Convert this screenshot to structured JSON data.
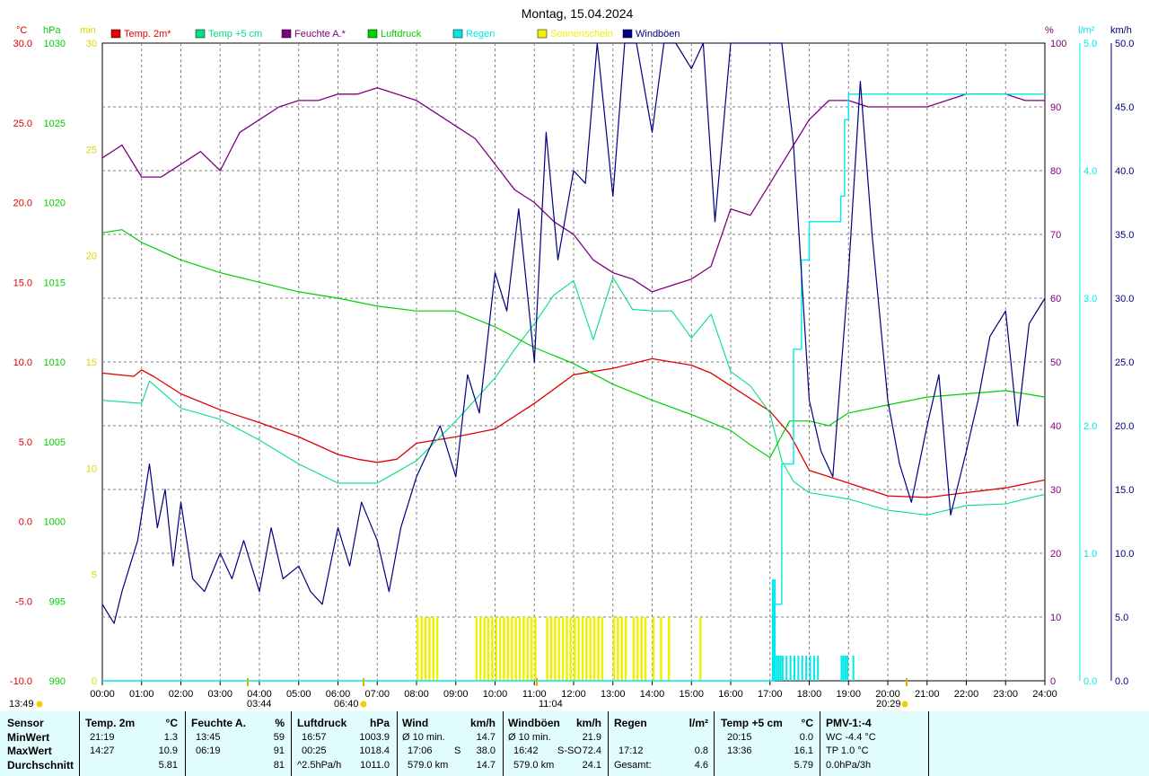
{
  "title": "Montag, 15.04.2024",
  "colors": {
    "temp2m": "#e00000",
    "temp5cm": "#00e080",
    "feuchte": "#800080",
    "luftdruck": "#00d000",
    "regen": "#00e8e8",
    "sonne": "#f0f000",
    "wind": "#000080",
    "grid": "#808080",
    "panel": "#e1fcfc"
  },
  "legend": [
    {
      "key": "temp2m",
      "label": "Temp. 2m*",
      "color": "#e00000"
    },
    {
      "key": "temp5cm",
      "label": "Temp +5 cm",
      "color": "#00e080"
    },
    {
      "key": "feuchte",
      "label": "Feuchte A.*",
      "color": "#800080"
    },
    {
      "key": "luftdruck",
      "label": "Luftdruck",
      "color": "#00d000"
    },
    {
      "key": "regen",
      "label": "Regen",
      "color": "#00e8e8"
    },
    {
      "key": "sonne",
      "label": "Sonnenschein",
      "color": "#f0f000"
    },
    {
      "key": "wind",
      "label": "Windböen",
      "color": "#000080"
    }
  ],
  "chart_data": {
    "type": "line",
    "title": "Montag, 15.04.2024",
    "x_ticks": [
      "00:00",
      "01:00",
      "02:00",
      "03:00",
      "04:00",
      "05:00",
      "06:00",
      "07:00",
      "08:00",
      "09:00",
      "10:00",
      "11:00",
      "12:00",
      "13:00",
      "14:00",
      "15:00",
      "16:00",
      "17:00",
      "18:00",
      "19:00",
      "20:00",
      "21:00",
      "22:00",
      "23:00",
      "24:00"
    ],
    "axes": {
      "temp_c": {
        "unit": "°C",
        "range": [
          -10,
          30
        ],
        "ticks": [
          "30.0",
          "25.0",
          "20.0",
          "15.0",
          "10.0",
          "5.0",
          "0.0",
          "-5.0",
          "-10.0"
        ]
      },
      "pressure_hpa": {
        "unit": "hPa",
        "range": [
          990,
          1030
        ],
        "ticks": [
          "1030",
          "1025",
          "1020",
          "1015",
          "1010",
          "1005",
          "1000",
          "995",
          "990"
        ]
      },
      "sun_min": {
        "unit": "min",
        "range": [
          0,
          30
        ],
        "ticks": [
          "30",
          "25",
          "20",
          "15",
          "10",
          "5",
          "0"
        ]
      },
      "humidity_pct": {
        "unit": "%",
        "range": [
          0,
          100
        ],
        "ticks": [
          "100",
          "90",
          "80",
          "70",
          "60",
          "50",
          "40",
          "30",
          "20",
          "10",
          "0"
        ]
      },
      "rain_l": {
        "unit": "l/m²",
        "range": [
          0,
          5
        ],
        "ticks": [
          "5.0",
          "4.0",
          "3.0",
          "2.0",
          "1.0",
          "0.0"
        ]
      },
      "wind_kmh": {
        "unit": "km/h",
        "range": [
          0,
          50
        ],
        "ticks": [
          "50.0",
          "45.0",
          "40.0",
          "35.0",
          "30.0",
          "25.0",
          "20.0",
          "15.0",
          "10.0",
          "5.0",
          "0.0"
        ]
      }
    },
    "series": [
      {
        "name": "Temp. 2m*",
        "axis": "temp_c",
        "x": [
          0,
          0.8,
          1,
          1.3,
          2,
          3,
          4,
          5,
          6,
          6.5,
          7,
          7.5,
          8,
          9,
          10,
          11,
          12,
          13,
          14,
          14.5,
          15,
          15.5,
          16,
          17,
          17.5,
          18,
          18.5,
          19,
          20,
          21,
          22,
          23,
          24
        ],
        "y": [
          9.3,
          9.1,
          9.5,
          9.1,
          8.0,
          7.0,
          6.2,
          5.3,
          4.2,
          3.9,
          3.7,
          3.9,
          4.9,
          5.3,
          5.8,
          7.4,
          9.2,
          9.6,
          10.2,
          10.0,
          9.8,
          9.3,
          8.5,
          6.9,
          5.5,
          3.2,
          2.8,
          2.4,
          1.6,
          1.5,
          1.8,
          2.1,
          2.6
        ]
      },
      {
        "name": "Temp +5 cm",
        "axis": "temp_c",
        "x": [
          0,
          1,
          1.2,
          2,
          3,
          4,
          5,
          6,
          7,
          8,
          9,
          10,
          10.5,
          11,
          11.5,
          12,
          12.5,
          13,
          13.5,
          14,
          14.5,
          15,
          15.5,
          16,
          16.5,
          17,
          17.3,
          17.6,
          18,
          19,
          20,
          21,
          22,
          23,
          24
        ],
        "y": [
          7.6,
          7.4,
          8.8,
          7.1,
          6.4,
          5.1,
          3.6,
          2.4,
          2.4,
          3.8,
          6.3,
          9.0,
          10.8,
          12.4,
          14.2,
          15.1,
          11.4,
          15.3,
          13.3,
          13.2,
          13.2,
          11.5,
          13.0,
          9.4,
          8.5,
          6.8,
          3.8,
          2.5,
          1.8,
          1.4,
          0.7,
          0.4,
          1.0,
          1.1,
          1.7
        ]
      },
      {
        "name": "Feuchte A.*",
        "axis": "humidity_pct",
        "x": [
          0,
          0.5,
          1,
          1.5,
          2,
          2.5,
          3,
          3.5,
          4,
          4.5,
          5,
          5.5,
          6,
          6.5,
          7,
          7.5,
          8,
          8.5,
          9,
          9.5,
          10,
          10.5,
          11,
          11.5,
          12,
          12.5,
          13,
          13.5,
          14,
          14.5,
          15,
          15.5,
          16,
          16.5,
          17,
          17.5,
          18,
          18.5,
          19,
          19.5,
          20,
          20.5,
          21,
          21.5,
          22,
          22.5,
          23,
          23.5,
          24
        ],
        "y": [
          82,
          84,
          79,
          79,
          81,
          83,
          80,
          86,
          88,
          90,
          91,
          91,
          92,
          92,
          93,
          92,
          91,
          89,
          87,
          85,
          81,
          77,
          75,
          72,
          70,
          66,
          64,
          63,
          61,
          62,
          63,
          65,
          74,
          73,
          78,
          83,
          88,
          91,
          91,
          90,
          90,
          90,
          90,
          91,
          92,
          92,
          92,
          91,
          91
        ]
      },
      {
        "name": "Luftdruck",
        "axis": "pressure_hpa",
        "x": [
          0,
          0.5,
          1,
          2,
          3,
          4,
          5,
          6,
          7,
          8,
          9,
          10,
          11,
          12,
          13,
          14,
          15,
          16,
          16.5,
          17,
          17.5,
          18,
          18.5,
          19,
          20,
          21,
          22,
          23,
          24
        ],
        "y": [
          1018.1,
          1018.3,
          1017.5,
          1016.4,
          1015.6,
          1015.0,
          1014.4,
          1014.0,
          1013.5,
          1013.2,
          1013.2,
          1012.2,
          1010.9,
          1009.9,
          1008.6,
          1007.6,
          1006.7,
          1005.7,
          1004.8,
          1004.0,
          1006.3,
          1006.3,
          1006.0,
          1006.8,
          1007.3,
          1007.8,
          1008.0,
          1008.2,
          1007.8
        ]
      },
      {
        "name": "Regen",
        "axis": "rain_l",
        "x": [
          0,
          17.0,
          17.1,
          17.3,
          17.6,
          17.8,
          18.0,
          18.2,
          18.5,
          18.8,
          18.9,
          19.0,
          19.5,
          20,
          24
        ],
        "y": [
          0,
          0,
          0.6,
          1.7,
          2.6,
          3.3,
          3.6,
          3.6,
          3.6,
          3.8,
          4.4,
          4.6,
          4.6,
          4.6,
          4.6
        ]
      },
      {
        "name": "Windböen",
        "axis": "wind_kmh",
        "x": [
          0,
          0.3,
          0.5,
          0.7,
          0.9,
          1.2,
          1.4,
          1.6,
          1.8,
          2.0,
          2.3,
          2.6,
          3.0,
          3.3,
          3.6,
          4.0,
          4.3,
          4.6,
          5.0,
          5.3,
          5.6,
          6.0,
          6.3,
          6.6,
          7.0,
          7.3,
          7.6,
          8.0,
          8.3,
          8.6,
          9.0,
          9.3,
          9.6,
          10.0,
          10.3,
          10.6,
          11.0,
          11.3,
          11.6,
          12.0,
          12.3,
          12.6,
          13.0,
          13.3,
          13.6,
          14.0,
          14.3,
          14.6,
          15.0,
          15.3,
          15.6,
          16.0,
          16.3,
          16.6,
          17.0,
          17.3,
          17.6,
          18.0,
          18.3,
          18.6,
          19.0,
          19.3,
          19.6,
          20.0,
          20.3,
          20.6,
          21.0,
          21.3,
          21.6,
          22.0,
          22.3,
          22.6,
          23.0,
          23.3,
          23.6,
          24.0
        ],
        "y": [
          6,
          4.5,
          7,
          9,
          11,
          17,
          12,
          15,
          9,
          14,
          8,
          7,
          10,
          8,
          11,
          7,
          12,
          8,
          9,
          7,
          6,
          12,
          9,
          14,
          11,
          7,
          12,
          16,
          18,
          20,
          16,
          24,
          21,
          32,
          29,
          37,
          25,
          43,
          33,
          40,
          39,
          56,
          38,
          50,
          55,
          43,
          62,
          53,
          48,
          55,
          36,
          58,
          55,
          60,
          61,
          54,
          42,
          22,
          18,
          16,
          32,
          47,
          35,
          22,
          17,
          14,
          20,
          24,
          13,
          18,
          22,
          27,
          29,
          20,
          28,
          30
        ]
      }
    ],
    "sunshine_bars_hours": [
      8.0,
      8.1,
      8.2,
      8.3,
      8.4,
      8.5,
      9.5,
      9.6,
      9.7,
      9.8,
      9.9,
      10.0,
      10.1,
      10.2,
      10.3,
      10.4,
      10.5,
      10.6,
      10.7,
      10.8,
      10.9,
      11.0,
      11.3,
      11.4,
      11.5,
      11.6,
      11.7,
      11.8,
      11.9,
      12.0,
      12.1,
      12.2,
      12.3,
      12.4,
      12.5,
      12.6,
      12.7,
      13.0,
      13.1,
      13.2,
      13.3,
      13.5,
      13.6,
      13.7,
      13.8,
      14.0,
      14.2,
      14.4,
      15.2
    ],
    "rain_spikes_hours": [
      17.05,
      17.1,
      17.15,
      17.2,
      17.25,
      17.3,
      17.4,
      17.5,
      17.6,
      17.7,
      17.8,
      17.9,
      18.0,
      18.1,
      18.2,
      18.8,
      18.85,
      18.9,
      18.95,
      19.1
    ]
  },
  "bottom_labels": {
    "left_time": "13:49",
    "sunrise_arrow": "03:44",
    "sunrise": "06:40",
    "noon": "11:04",
    "sunset": "20:29"
  },
  "table": {
    "rows": [
      "Sensor",
      "MinWert",
      "MaxWert",
      "Durchschnitt"
    ],
    "temp2m": {
      "head": "Temp. 2m",
      "unit": "°C",
      "min_t": "21:19",
      "min_v": "1.3",
      "max_t": "14:27",
      "max_v": "10.9",
      "avg": "5.81"
    },
    "feuchte": {
      "head": "Feuchte A.",
      "unit": "%",
      "min_t": "13:45",
      "min_v": "59",
      "max_t": "06:19",
      "max_v": "91",
      "avg": "81"
    },
    "luftdruck": {
      "head": "Luftdruck",
      "unit": "hPa",
      "min_t": "16:57",
      "min_v": "1003.9",
      "max_t": "00:25",
      "max_v": "1018.4",
      "avg_l": "^2.5hPa/h",
      "avg": "1011.0"
    },
    "wind": {
      "head": "Wind",
      "unit": "km/h",
      "min_t": "Ø 10 min.",
      "min_v": "14.7",
      "max_t": "17:06",
      "max_dir": "S",
      "max_v": "38.0",
      "avg_l": "579.0 km",
      "avg": "14.7"
    },
    "boeen": {
      "head": "Windböen",
      "unit": "km/h",
      "min_t": "Ø 10 min.",
      "min_v": "21.9",
      "max_t": "16:42",
      "max_dir": "S-SO",
      "max_v": "72.4",
      "avg_l": "579.0 km",
      "avg": "24.1"
    },
    "regen": {
      "head": "Regen",
      "unit": "l/m²",
      "max_t": "17:12",
      "max_v": "0.8",
      "avg_l": "Gesamt:",
      "avg": "4.6"
    },
    "temp5cm": {
      "head": "Temp +5 cm",
      "unit": "°C",
      "min_t": "20:15",
      "min_v": "0.0",
      "max_t": "13:36",
      "max_v": "16.1",
      "avg": "5.79"
    },
    "pmv": {
      "head": "PMV-1:-4",
      "l1": "WC -4.4 °C",
      "l2": "TP 1.0 °C",
      "l3": "0.0hPa/3h"
    }
  }
}
